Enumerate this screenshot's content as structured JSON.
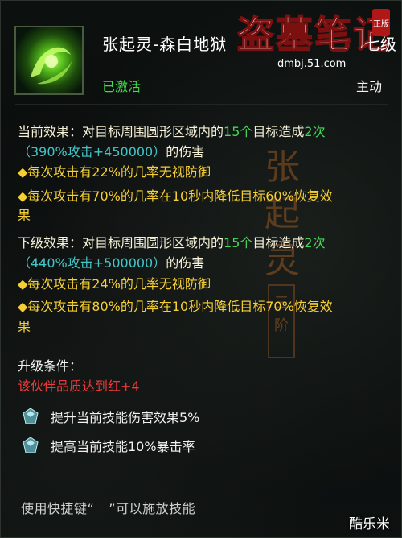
{
  "skill": {
    "name": "张起灵-森白地狱",
    "level": "七级",
    "status": "已激活",
    "type": "主动"
  },
  "logo": {
    "title": "盗墓笔记",
    "url": "dmbj.51.com",
    "badge": "正版"
  },
  "current": {
    "label": "当前效果：",
    "desc_a": "对目标周围圆形区域内的",
    "count": "15个",
    "desc_b": "目标造成",
    "times": "2次",
    "formula": "（390%攻击+450000）",
    "damage": "的伤害",
    "bullet1": "◆每次攻击有22%的几率无视防御",
    "bullet2_line1": "◆每次攻击有70%的几率在10秒内降低目标60%恢复效",
    "bullet2_line2": "果"
  },
  "next": {
    "label": "下级效果：",
    "desc_a": "对目标周围圆形区域内的",
    "count": "15个",
    "desc_b": "目标造成",
    "times": "2次",
    "formula": "（440%攻击+500000）",
    "damage": "的伤害",
    "bullet1": "◆每次攻击有24%的几率无视防御",
    "bullet2_line1": "◆每次攻击有80%的几率在10秒内降低目标70%恢复效",
    "bullet2_line2": "果"
  },
  "upgrade": {
    "label": "升级条件：",
    "requirement": "该伙伴品质达到红+4"
  },
  "gems": [
    {
      "icon": "gem-icon",
      "text": "提升当前技能伤害效果5%"
    },
    {
      "icon": "gem-icon",
      "text": "提高当前技能10%暴击率"
    }
  ],
  "hint": {
    "prefix": "使用快捷键“",
    "key": "",
    "suffix": "”可以施放技能"
  },
  "background_chars": [
    "张",
    "起",
    "灵"
  ],
  "seal_text": "三阶",
  "watermark": "酷乐米",
  "colors": {
    "green": "#46d65a",
    "cyan": "#44c6c8",
    "yellow": "#f6cf34",
    "red": "#ee3a3a"
  }
}
